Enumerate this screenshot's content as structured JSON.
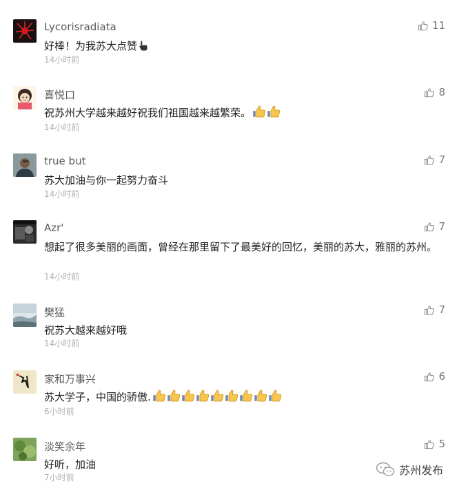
{
  "comments": [
    {
      "name": "Lycorisradiata",
      "text": "好棒！为我苏大点赞",
      "time": "14小时前",
      "likes": "11",
      "avatar_icon": "red-flower-avatar",
      "emoji": "pointing-hand-icon",
      "emoji_count": 1
    },
    {
      "name": "喜悦口",
      "text": "祝苏州大学越来越好祝我们祖国越来越繁荣。",
      "time": "14小时前",
      "likes": "8",
      "avatar_icon": "cartoon-girl-avatar",
      "emoji": "thumbs-up-emoji",
      "emoji_count": 2
    },
    {
      "name": "true but",
      "text": "苏大加油与你一起努力奋斗",
      "time": "14小时前",
      "likes": "7",
      "avatar_icon": "man-photo-avatar",
      "emoji_count": 0
    },
    {
      "name": "Azr'",
      "text": "想起了很多美丽的画面，曾经在那里留下了最美好的回忆，美丽的苏大，雅丽的苏州。",
      "time": "14小时前",
      "likes": "7",
      "avatar_icon": "dark-photo-avatar",
      "emoji_count": 0
    },
    {
      "name": "樊猛",
      "text": "祝苏大越来越好哦",
      "time": "14小时前",
      "likes": "7",
      "avatar_icon": "landscape-avatar",
      "emoji_count": 0
    },
    {
      "name": "家和万事兴",
      "text": "苏大学子，中国的骄傲.",
      "time": "6小时前",
      "likes": "6",
      "avatar_icon": "calligraphy-avatar",
      "emoji": "thumbs-up-emoji",
      "emoji_count": 9
    },
    {
      "name": "淡笑余年",
      "text": "好听，加油",
      "time": "7小时前",
      "likes": "5",
      "avatar_icon": "green-nature-avatar",
      "emoji_count": 0
    }
  ],
  "watermark": {
    "label": "苏州发布",
    "icon": "wechat-icon"
  },
  "colors": {
    "name": "#5a5a5a",
    "text": "#222222",
    "time": "#b0b0b0",
    "like": "#777777"
  }
}
